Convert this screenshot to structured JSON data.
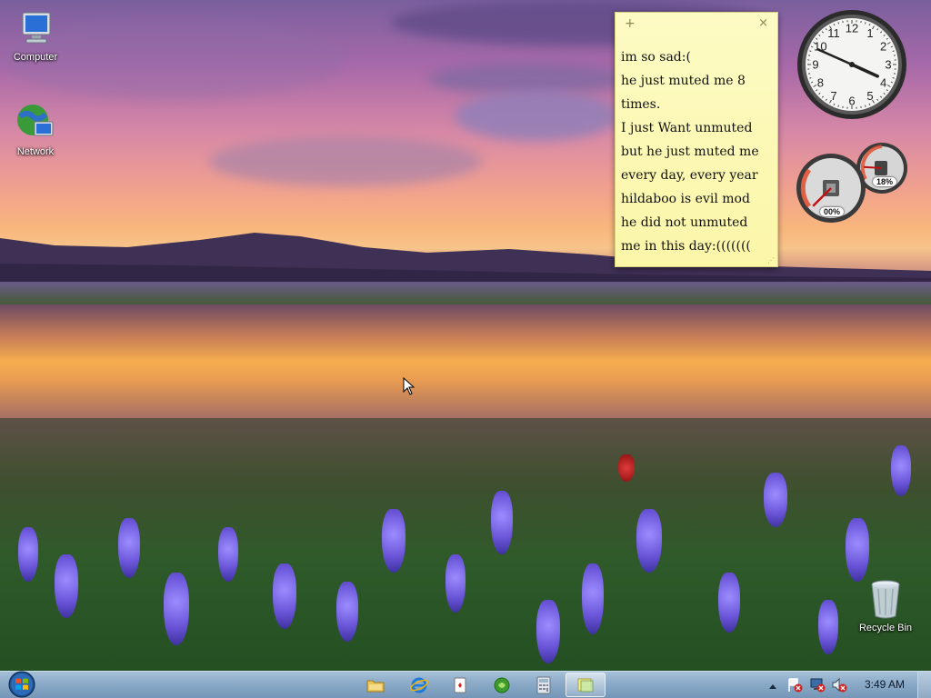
{
  "desktop": {
    "icons": [
      {
        "label": "Computer",
        "icon": "computer-icon"
      },
      {
        "label": "Network",
        "icon": "network-icon"
      },
      {
        "label": "Recycle Bin",
        "icon": "recycle-bin-icon"
      }
    ]
  },
  "sticky_note": {
    "add_symbol": "+",
    "close_symbol": "×",
    "lines": [
      "im so sad:(",
      "he just muted me 8",
      "times.",
      "I just Want unmuted",
      "but he just muted me",
      "every day, every year",
      "hildaboo is evil mod",
      "he did not unmuted",
      "me in this day:((((((("
    ]
  },
  "clock_gadget": {
    "numbers": [
      "12",
      "1",
      "2",
      "3",
      "4",
      "5",
      "6",
      "7",
      "8",
      "9",
      "10",
      "11"
    ],
    "time_shown": "3:49"
  },
  "cpu_meter_gadget": {
    "cpu_readout": "00%",
    "memory_readout": "18%",
    "cpu_level": 0.0,
    "memory_level": 0.18
  },
  "taskbar": {
    "start_icon": "windows-orb-icon",
    "pinned": [
      {
        "name": "explorer-icon"
      },
      {
        "name": "internet-explorer-icon"
      },
      {
        "name": "solitaire-icon"
      },
      {
        "name": "media-center-icon"
      },
      {
        "name": "calculator-icon"
      },
      {
        "name": "sticky-notes-icon",
        "active": true
      }
    ],
    "tray": {
      "time": "3:49 AM",
      "icons": [
        "show-hidden-icons-icon",
        "action-center-icon",
        "network-status-icon",
        "volume-muted-icon"
      ]
    }
  },
  "colors": {
    "sticky_bg": "#fbf6a8",
    "taskbar": "#8aaac8",
    "tray_error_red": "#d32020"
  }
}
